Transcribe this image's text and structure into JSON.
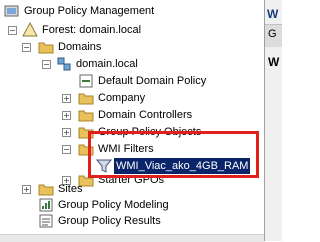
{
  "tree": {
    "root_label": "Group Policy Management",
    "forest_label": "Forest: domain.local",
    "domains_label": "Domains",
    "domain_label": "domain.local",
    "default_policy_label": "Default Domain Policy",
    "company_label": "Company",
    "domain_controllers_label": "Domain Controllers",
    "gpo_label": "Group Policy Objects",
    "wmi_filters_label": "WMI Filters",
    "wmi_filter_item_label": "WMI_Viac_ako_4GB_RAM",
    "starter_gpos_label": "Starter GPOs",
    "sites_label": "Sites",
    "modeling_label": "Group Policy Modeling",
    "results_label": "Group Policy Results"
  },
  "right_pane": {
    "title_fragment": "W",
    "tab_fragment": "G",
    "heading_fragment": "W"
  },
  "colors": {
    "selection": "#0a246a",
    "highlight_border": "#e0201c",
    "folder": "#e8c15a"
  }
}
